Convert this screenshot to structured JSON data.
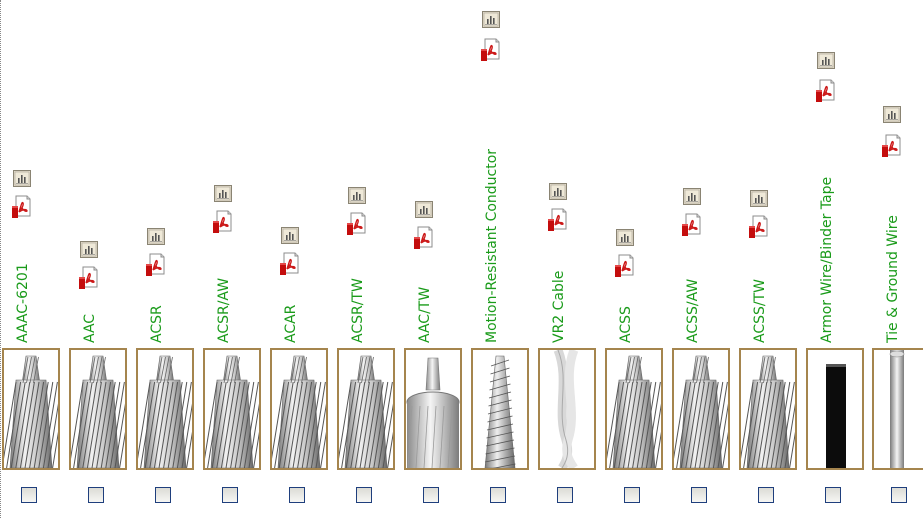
{
  "products": [
    {
      "label": "AAAC-6201",
      "image": "stranded-conductor"
    },
    {
      "label": "AAC",
      "image": "stranded-conductor"
    },
    {
      "label": "ACSR",
      "image": "stranded-conductor"
    },
    {
      "label": "ACSR/AW",
      "image": "stranded-conductor"
    },
    {
      "label": "ACAR",
      "image": "stranded-conductor"
    },
    {
      "label": "ACSR/TW",
      "image": "stranded-conductor"
    },
    {
      "label": "AAC/TW",
      "image": "trapezoidal-conductor"
    },
    {
      "label": "Motion-Resistant Conductor",
      "image": "twisted-conductor"
    },
    {
      "label": "VR2 Cable",
      "image": "twisted-pair-cable"
    },
    {
      "label": "ACSS",
      "image": "stranded-conductor"
    },
    {
      "label": "ACSS/AW",
      "image": "stranded-conductor"
    },
    {
      "label": "ACSS/TW",
      "image": "stranded-conductor"
    },
    {
      "label": "Armor Wire/Binder Tape",
      "image": "binder-tape"
    },
    {
      "label": "Tie & Ground Wire",
      "image": "solid-wire"
    }
  ],
  "colors": {
    "label": "#1a9b1a",
    "thumb_border": "#a5854e",
    "checkbox_border": "#1f3f7d"
  },
  "icons": {
    "spreadsheet": "spreadsheet-icon",
    "pdf": "pdf-icon"
  }
}
